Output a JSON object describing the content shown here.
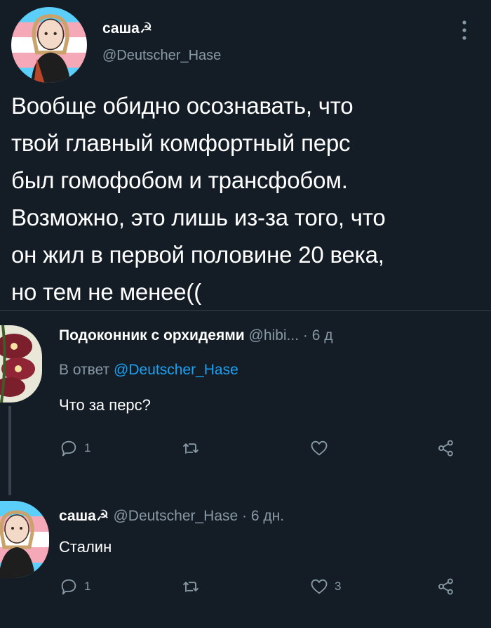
{
  "main_tweet": {
    "name": "саша☭",
    "handle": "@Deutscher_Hase",
    "text": "Вообще обидно осознавать, что\nтвой главный комфортный перс\nбыл гомофобом и трансфобом.\nВозможно, это лишь из-за того, что\nон жил в первой половине 20 века,\nно тем не менее(("
  },
  "replies": [
    {
      "name": "Подоконник с орхидеями",
      "handle": "@hibi...",
      "time": "· 6 д",
      "reply_to_prefix": "В ответ ",
      "reply_to_mention": "@Deutscher_Hase",
      "text": "Что за перс?",
      "reply_count": "1",
      "retweet_count": "",
      "like_count": ""
    },
    {
      "name": "саша☭",
      "handle": "@Deutscher_Hase",
      "time": "· 6 дн.",
      "text": "Сталин",
      "reply_count": "1",
      "retweet_count": "",
      "like_count": "3"
    }
  ],
  "icons": {
    "more": "more-vertical-icon",
    "reply": "comment-icon",
    "retweet": "retweet-icon",
    "like": "heart-icon",
    "share": "share-icon"
  },
  "colors": {
    "background": "#141d26",
    "secondary_text": "#8899a6",
    "link": "#1da1f2",
    "divider": "#38444d"
  }
}
